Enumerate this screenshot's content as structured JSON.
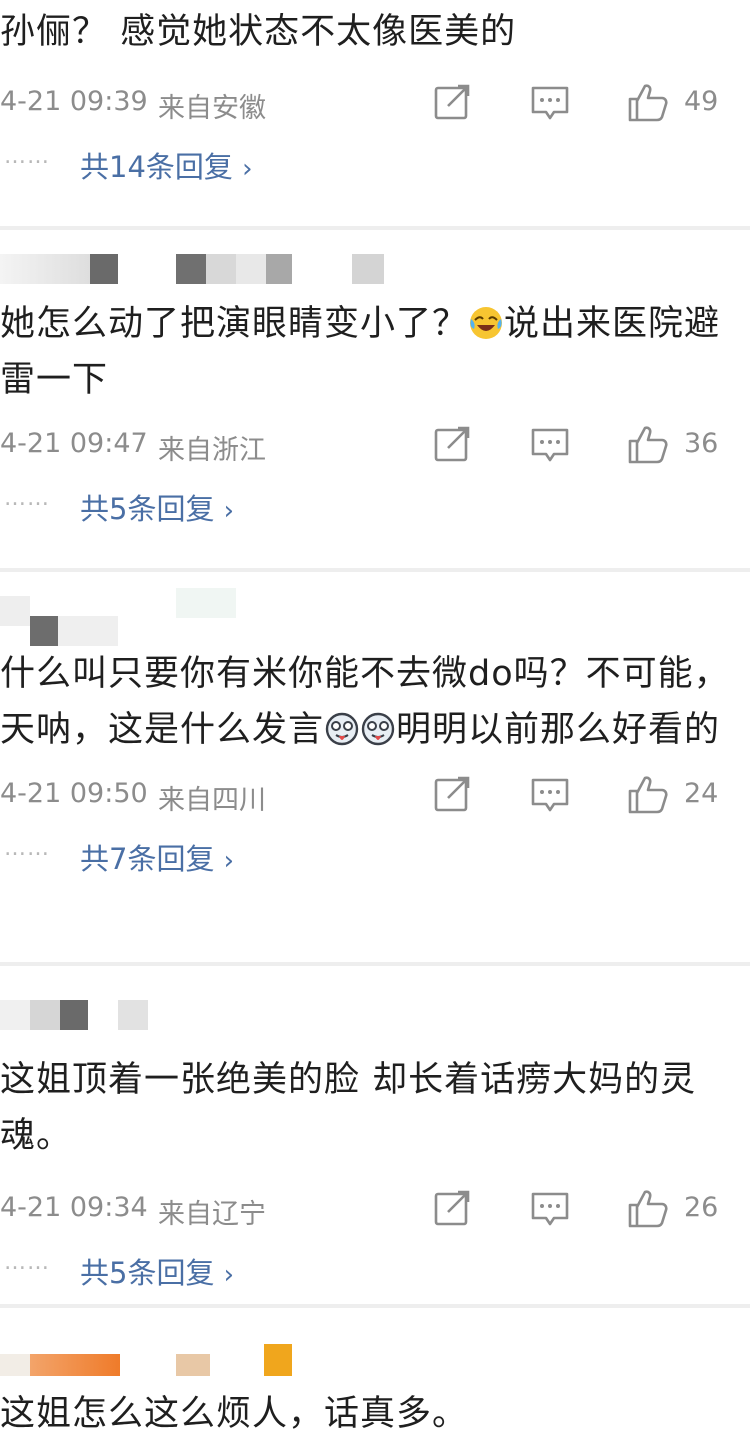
{
  "comments": [
    {
      "text": "孙俪？ 感觉她状态不太像医美的",
      "time": "4-21 09:39",
      "location": "来自安徽",
      "likes": "49",
      "reply_label": "共14条回复",
      "dots": "……"
    },
    {
      "text_a": "她怎么动了把演眼睛变小了？",
      "text_b": "说出来医院避雷一下",
      "time": "4-21 09:47",
      "location": "来自浙江",
      "likes": "36",
      "reply_label": "共5条回复",
      "dots": "……"
    },
    {
      "text_a": "什么叫只要你有米你能不去微do吗？不可能， 天呐，这是什么发言",
      "text_b": "明明以前那么好看的",
      "time": "4-21 09:50",
      "location": "来自四川",
      "likes": "24",
      "reply_label": "共7条回复",
      "dots": "……"
    },
    {
      "text": "这姐顶着一张绝美的脸 却长着话痨大妈的灵魂。",
      "time": "4-21 09:34",
      "location": "来自辽宁",
      "likes": "26",
      "reply_label": "共5条回复",
      "dots": "……"
    },
    {
      "text": "这姐怎么这么烦人，话真多。"
    }
  ],
  "icons": {
    "share": "share-icon",
    "comment": "comment-icon",
    "like": "thumbs-up-icon",
    "chevron": "chevron-right-icon",
    "emoji_laugh": "laugh-cry-emoji-icon",
    "emoji_tongue": "tongue-out-emoji-icon"
  },
  "colors": {
    "reply_link": "#4a6fa5",
    "meta_gray": "#8c8c8c",
    "divider": "#eeeeee"
  }
}
